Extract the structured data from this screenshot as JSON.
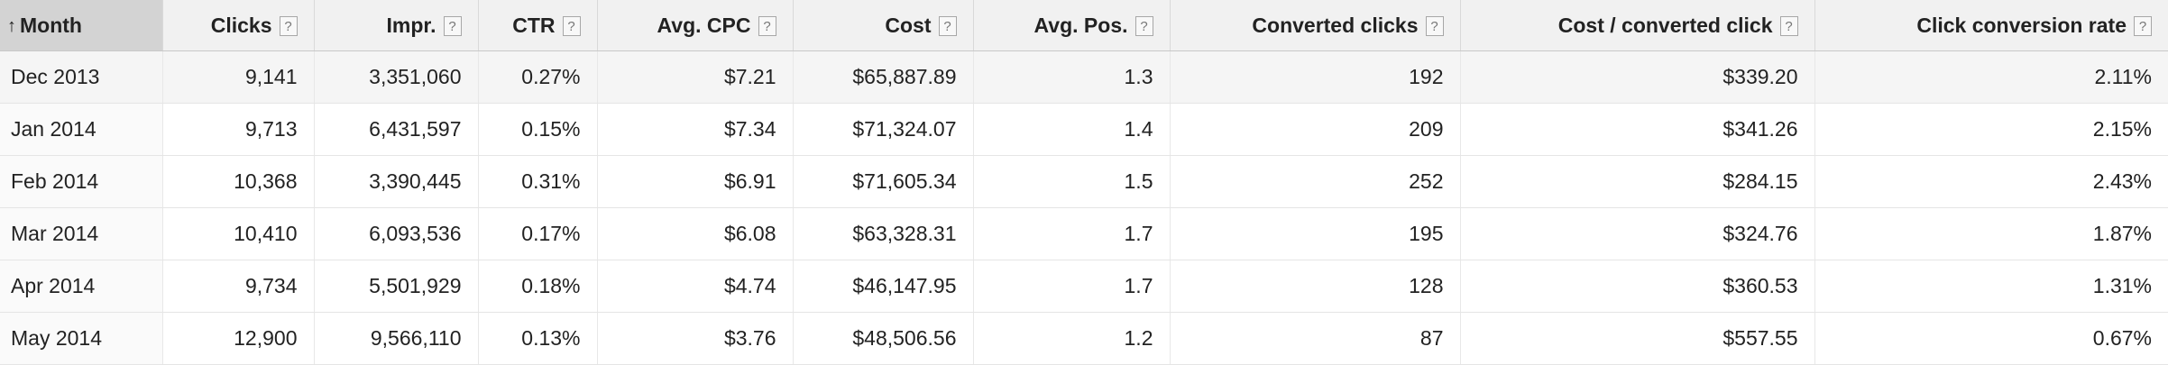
{
  "table": {
    "headers": [
      "Month",
      "Clicks",
      "Impr.",
      "CTR",
      "Avg. CPC",
      "Cost",
      "Avg. Pos.",
      "Converted clicks",
      "Cost / converted click",
      "Click conversion rate"
    ],
    "help_icon": "?",
    "sort_icon": "↑",
    "rows": [
      [
        "Dec 2013",
        "9,141",
        "3,351,060",
        "0.27%",
        "$7.21",
        "$65,887.89",
        "1.3",
        "192",
        "$339.20",
        "2.11%"
      ],
      [
        "Jan 2014",
        "9,713",
        "6,431,597",
        "0.15%",
        "$7.34",
        "$71,324.07",
        "1.4",
        "209",
        "$341.26",
        "2.15%"
      ],
      [
        "Feb 2014",
        "10,368",
        "3,390,445",
        "0.31%",
        "$6.91",
        "$71,605.34",
        "1.5",
        "252",
        "$284.15",
        "2.43%"
      ],
      [
        "Mar 2014",
        "10,410",
        "6,093,536",
        "0.17%",
        "$6.08",
        "$63,328.31",
        "1.7",
        "195",
        "$324.76",
        "1.87%"
      ],
      [
        "Apr 2014",
        "9,734",
        "5,501,929",
        "0.18%",
        "$4.74",
        "$46,147.95",
        "1.7",
        "128",
        "$360.53",
        "1.31%"
      ],
      [
        "May 2014",
        "12,900",
        "9,566,110",
        "0.13%",
        "$3.76",
        "$48,506.56",
        "1.2",
        "87",
        "$557.55",
        "0.67%"
      ]
    ]
  }
}
